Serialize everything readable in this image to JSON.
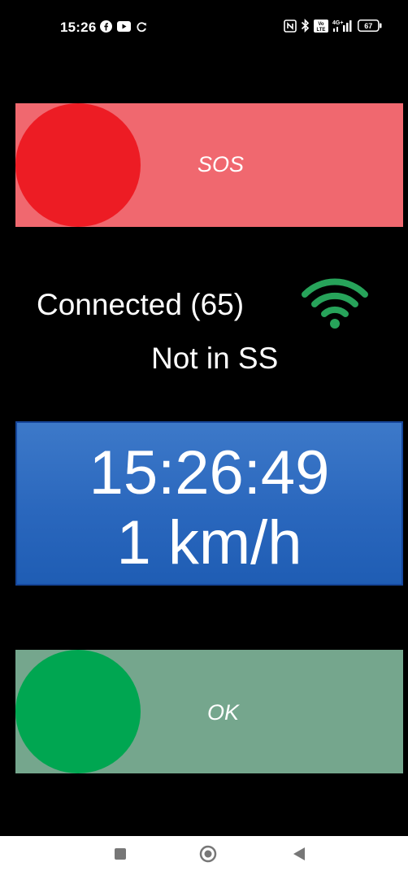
{
  "status_bar": {
    "time": "15:26",
    "left_icons": [
      "facebook-icon",
      "youtube-icon",
      "sync-icon"
    ],
    "right_icons": [
      "nfc-icon",
      "bluetooth-icon",
      "volte-icon",
      "signal-4g-icon",
      "battery-icon"
    ],
    "network_label": "4G+",
    "volte_label": "VoLTE",
    "battery_level": "67"
  },
  "sos": {
    "label": "SOS",
    "bar_color": "#f0686f",
    "circle_color": "#ed1c24"
  },
  "connection": {
    "status": "Connected (65)",
    "ss_status": "Not in SS",
    "wifi_icon": "wifi-icon",
    "wifi_color": "#27a35a"
  },
  "info_panel": {
    "time": "15:26:49",
    "speed": "1 km/h",
    "color": "#2a67bd"
  },
  "ok": {
    "label": "OK",
    "bar_color": "#75a68d",
    "circle_color": "#00a651"
  },
  "nav_bar": {
    "buttons": [
      "recents-square-icon",
      "home-circle-icon",
      "back-triangle-icon"
    ]
  }
}
